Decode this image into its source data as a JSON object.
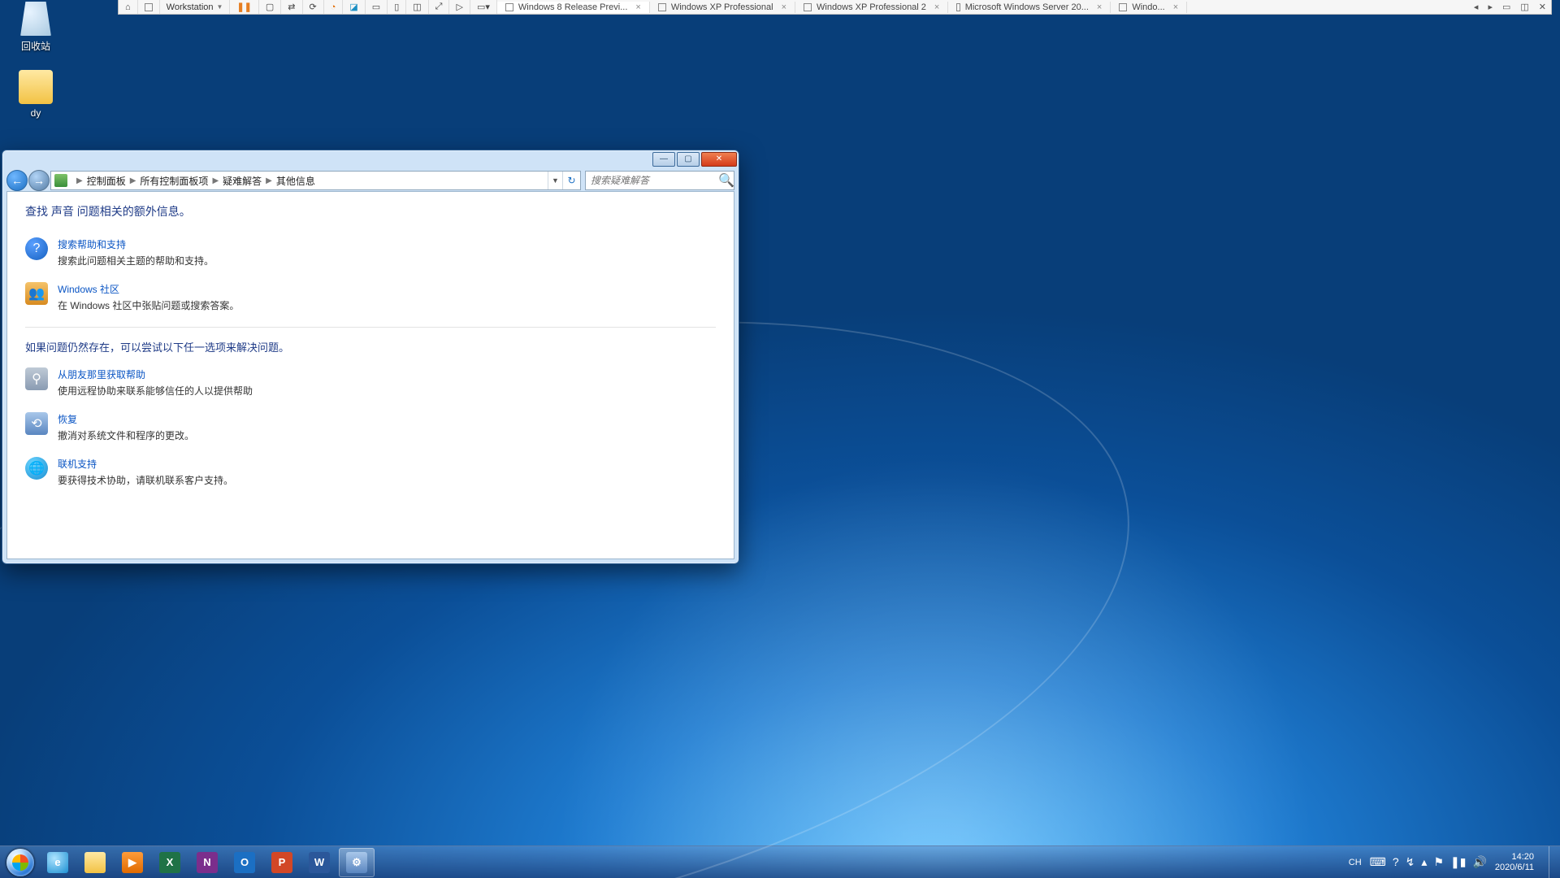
{
  "desktop": {
    "icons": {
      "recycle": "回收站",
      "folder": "dy"
    }
  },
  "vmware": {
    "workstation_label": "Workstation",
    "tabs": [
      {
        "label": "Windows 8 Release Previ...",
        "active": true
      },
      {
        "label": "Windows XP Professional",
        "active": false
      },
      {
        "label": "Windows XP Professional 2",
        "active": false
      },
      {
        "label": "Microsoft Windows Server 20...",
        "active": false
      },
      {
        "label": "Windo...",
        "active": false
      }
    ]
  },
  "window": {
    "breadcrumb": {
      "root": "控制面板",
      "level1": "所有控制面板项",
      "level2": "疑难解答",
      "level3": "其他信息"
    },
    "search_placeholder": "搜索疑难解答",
    "heading1": "查找 声音 问题相关的额外信息。",
    "heading2": "如果问题仍然存在，可以尝试以下任一选项来解决问题。",
    "items_a": [
      {
        "link": "搜索帮助和支持",
        "desc": "搜索此问题相关主题的帮助和支持。",
        "icon": "help"
      },
      {
        "link": "Windows 社区",
        "desc": "在 Windows 社区中张贴问题或搜索答案。",
        "icon": "comm"
      }
    ],
    "items_b": [
      {
        "link": "从朋友那里获取帮助",
        "desc": "使用远程协助来联系能够信任的人以提供帮助",
        "icon": "friend"
      },
      {
        "link": "恢复",
        "desc": "撤消对系统文件和程序的更改。",
        "icon": "restore"
      },
      {
        "link": "联机支持",
        "desc": "要获得技术协助，请联机联系客户支持。",
        "icon": "online"
      }
    ]
  },
  "tray": {
    "lang": "CH",
    "time": "14:20",
    "date": "2020/6/11"
  }
}
